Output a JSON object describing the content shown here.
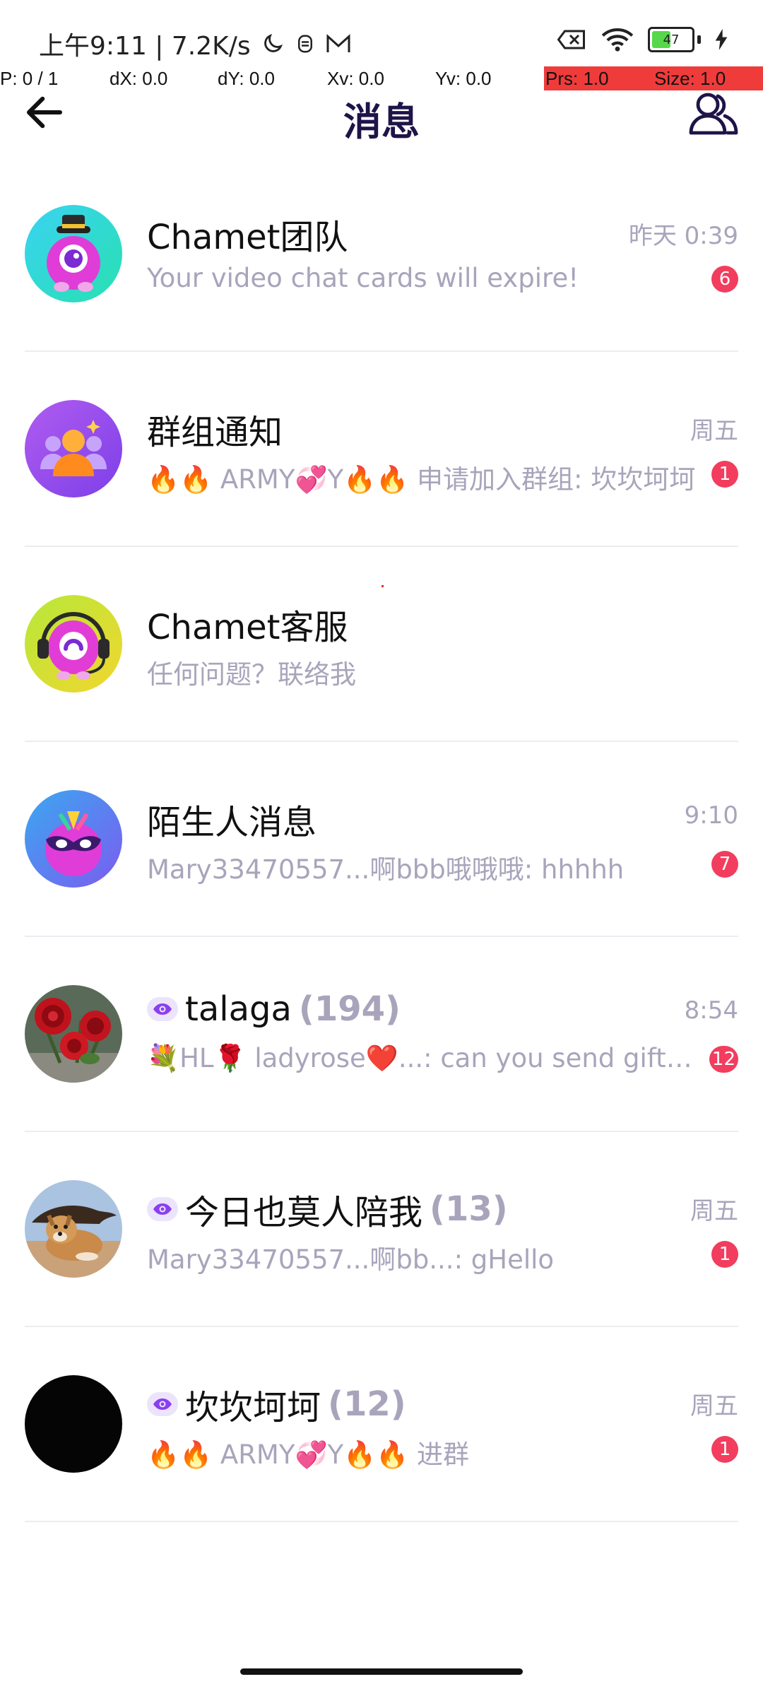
{
  "status_bar": {
    "time": "上午9:11 | 7.2K/s",
    "battery_level": "47"
  },
  "debug": {
    "p": "P: 0 / 1",
    "dx": "dX: 0.0",
    "dy": "dY: 0.0",
    "xv": "Xv: 0.0",
    "yv": "Yv: 0.0",
    "prs": "Prs: 1.0",
    "size": "Size: 1.0"
  },
  "header": {
    "title": "消息"
  },
  "conversations": [
    {
      "name": "Chamet团队",
      "count": "",
      "time": "昨天 0:39",
      "preview": "Your video chat cards will expire!",
      "badge": "6",
      "avatar": "mascot-hat-icon"
    },
    {
      "name": "群组通知",
      "count": "",
      "time": "周五",
      "preview": "🔥🔥 ARMY💞Y🔥🔥 申请加入群组: 坎坎坷坷",
      "badge": "1",
      "avatar": "group-people-icon"
    },
    {
      "name": "Chamet客服",
      "count": "",
      "time": "",
      "preview": "任何问题？联络我",
      "badge": "",
      "avatar": "mascot-headset-icon"
    },
    {
      "name": "陌生人消息",
      "count": "",
      "time": "9:10",
      "preview": "Mary33470557...啊bbb哦哦哦: hhhhh",
      "badge": "7",
      "avatar": "mascot-mask-icon"
    },
    {
      "name": "talaga",
      "count": "(194)",
      "time": "8:54",
      "preview": "💐HL🌹 ladyrose❤️...: can you send gift to me",
      "badge": "12",
      "avatar": "rose-photo"
    },
    {
      "name": "今日也莫人陪我",
      "count": "(13)",
      "time": "周五",
      "preview": "Mary33470557...啊bb...: gHello",
      "badge": "1",
      "avatar": "dog-photo"
    },
    {
      "name": "坎坎坷坷",
      "count": "(12)",
      "time": "周五",
      "preview": "🔥🔥 ARMY💞Y🔥🔥 进群",
      "badge": "1",
      "avatar": "black-circle"
    }
  ]
}
